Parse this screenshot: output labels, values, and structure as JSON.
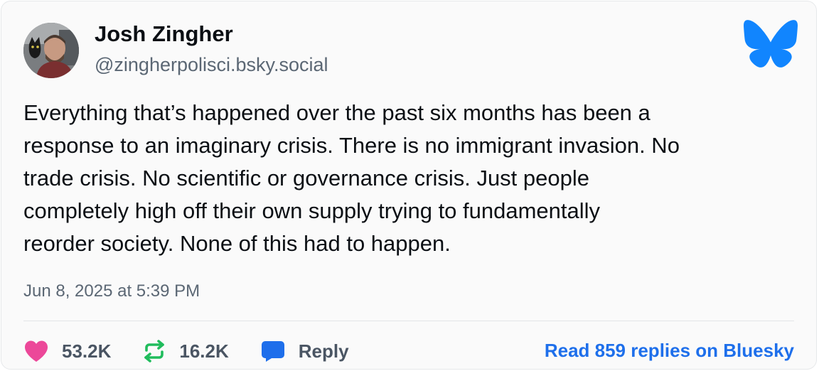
{
  "author": {
    "display_name": "Josh Zingher",
    "handle": "@zingherpolisci.bsky.social"
  },
  "post": {
    "lines": [
      "Everything that’s happened over the past six months has been a",
      "response to an imaginary crisis. There is no immigrant invasion. No",
      "trade crisis. No scientific or governance crisis. Just people",
      "completely high off their own supply trying to fundamentally",
      "reorder society. None of this had to happen."
    ],
    "timestamp": "Jun 8, 2025 at 5:39 PM"
  },
  "actions": {
    "likes": "53.2K",
    "reposts": "16.2K",
    "reply_label": "Reply",
    "read_replies_link": "Read 859 replies on Bluesky"
  },
  "icons": {
    "logo": "bluesky-butterfly-icon",
    "like": "heart-icon",
    "repost": "repost-arrows-icon",
    "reply": "speech-bubble-icon"
  },
  "colors": {
    "brand": "#1185fe",
    "like": "#ec4899",
    "repost": "#20bc5c",
    "reply": "#1e6feb",
    "link": "#1e6feb",
    "muted_text": "#5b6774",
    "card_background": "#fafafa"
  }
}
